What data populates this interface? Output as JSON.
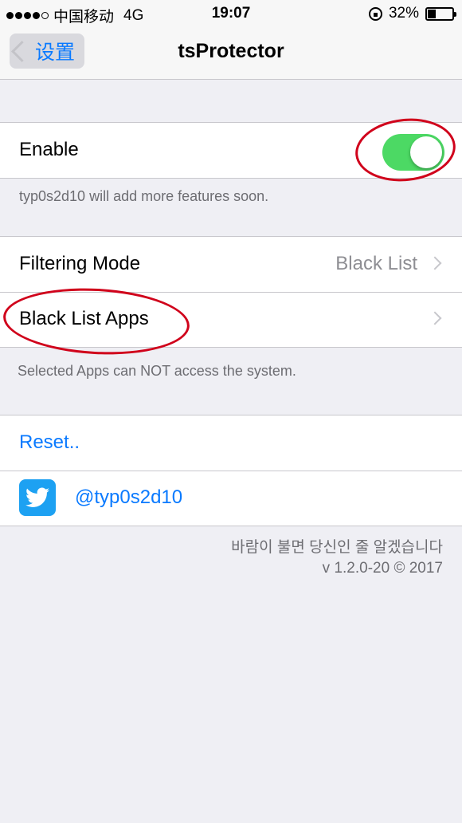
{
  "status_bar": {
    "carrier": "中国移动",
    "network": "4G",
    "time": "19:07",
    "battery": "32%",
    "battery_level": 0.32
  },
  "nav": {
    "back_label": "设置",
    "title": "tsProtector"
  },
  "enable_section": {
    "label": "Enable",
    "toggle_on": true,
    "footer": "typ0s2d10 will add more features soon."
  },
  "filter_section": {
    "filtering_mode_label": "Filtering Mode",
    "filtering_mode_value": "Black List",
    "black_list_apps_label": "Black List Apps",
    "footer": "Selected Apps can NOT access the system."
  },
  "links_section": {
    "reset_label": "Reset..",
    "twitter_handle": "@typ0s2d10"
  },
  "credits": {
    "tagline": "바람이 불면 당신인 줄 알겠습니다",
    "version": "v 1.2.0-20 © 2017"
  },
  "colors": {
    "accent": "#0a7aff",
    "toggle_on": "#4cd964",
    "annotation": "#d0021b",
    "twitter": "#1da1f2"
  }
}
